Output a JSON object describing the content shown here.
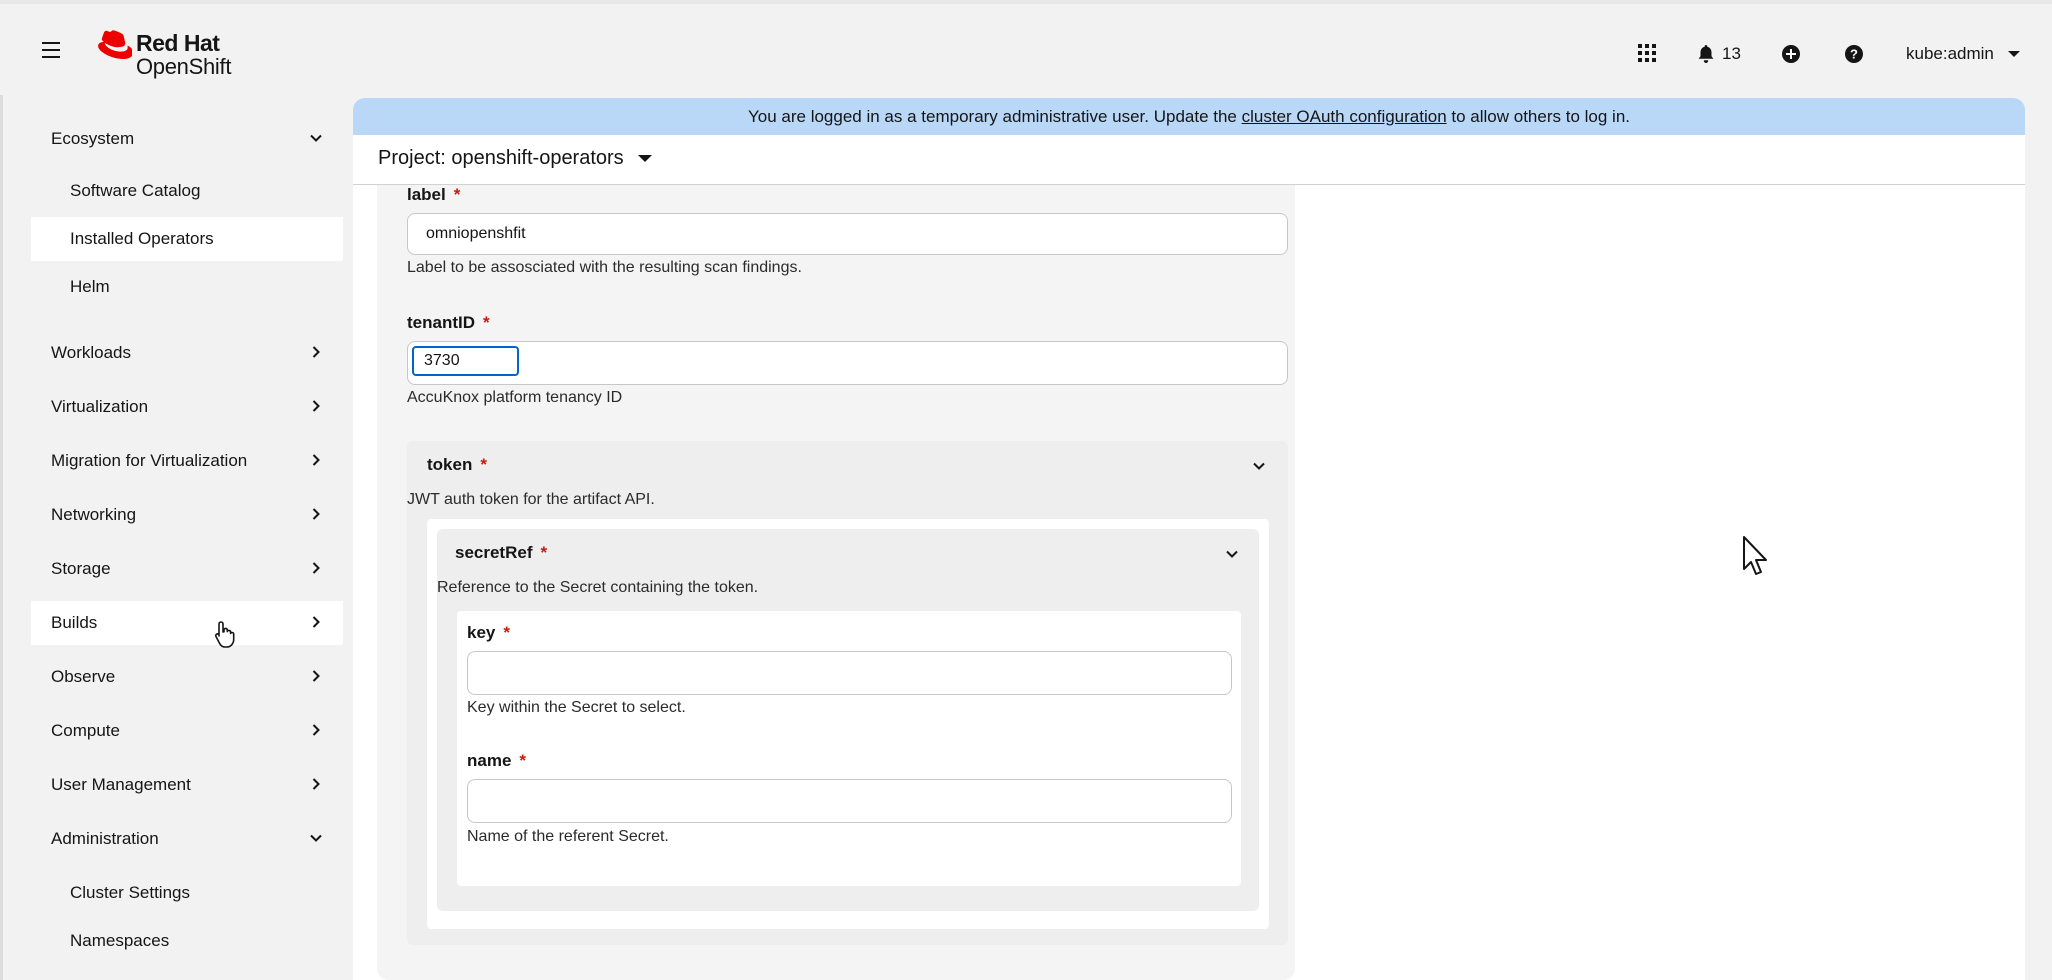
{
  "masthead": {
    "brand_line1": "Red Hat",
    "brand_line2": "OpenShift",
    "notifications_count": "13",
    "user": "kube:admin"
  },
  "sidebar": {
    "items": [
      {
        "label": "Ecosystem"
      },
      {
        "label": "Software Catalog"
      },
      {
        "label": "Installed Operators"
      },
      {
        "label": "Helm"
      },
      {
        "label": "Workloads"
      },
      {
        "label": "Virtualization"
      },
      {
        "label": "Migration for Virtualization"
      },
      {
        "label": "Networking"
      },
      {
        "label": "Storage"
      },
      {
        "label": "Builds"
      },
      {
        "label": "Observe"
      },
      {
        "label": "Compute"
      },
      {
        "label": "User Management"
      },
      {
        "label": "Administration"
      },
      {
        "label": "Cluster Settings"
      },
      {
        "label": "Namespaces"
      }
    ]
  },
  "banner": {
    "text_before": "You are logged in as a temporary administrative user. Update the ",
    "link": "cluster OAuth configuration",
    "text_after": " to allow others to log in."
  },
  "project": {
    "label": "Project: openshift-operators"
  },
  "form": {
    "label_field": {
      "label": "label",
      "value": "omniopenshfit",
      "help": "Label to be assosciated with the resulting scan findings."
    },
    "tenant_field": {
      "label": "tenantID",
      "value": "3730",
      "help": "AccuKnox platform tenancy ID"
    },
    "token": {
      "label": "token",
      "help": "JWT auth token for the artifact API.",
      "secretRef": {
        "label": "secretRef",
        "help": "Reference to the Secret containing the token.",
        "key": {
          "label": "key",
          "value": "",
          "help": "Key within the Secret to select."
        },
        "name": {
          "label": "name",
          "value": "",
          "help": "Name of the referent Secret."
        }
      }
    },
    "required_marker": "*"
  }
}
